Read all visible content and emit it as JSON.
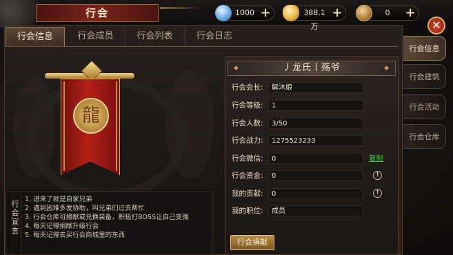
{
  "window": {
    "title": "行会"
  },
  "currency": [
    {
      "icon": "diamond-icon",
      "value": "1000"
    },
    {
      "icon": "gold-ingot-icon",
      "value": "388.1万"
    },
    {
      "icon": "coin-icon",
      "value": "0"
    }
  ],
  "tabs": [
    {
      "label": "行会信息",
      "active": true
    },
    {
      "label": "行会成员",
      "active": false
    },
    {
      "label": "行会列表",
      "active": false
    },
    {
      "label": "行会日志",
      "active": false
    }
  ],
  "side_tabs": [
    {
      "label": "行会信息",
      "active": true
    },
    {
      "label": "行会建筑",
      "active": false
    },
    {
      "label": "行会活动",
      "active": false
    },
    {
      "label": "行会仓库",
      "active": false
    }
  ],
  "guild": {
    "name": "丿龙氏丨殇爷",
    "fields": [
      {
        "label": "行会会长:",
        "value": "解沐娘"
      },
      {
        "label": "行会等级:",
        "value": "1"
      },
      {
        "label": "行会人数:",
        "value": "3/50"
      },
      {
        "label": "行会战力:",
        "value": "1275523233"
      },
      {
        "label": "行会微信:",
        "value": "0"
      },
      {
        "label": "行会资金:",
        "value": "0"
      },
      {
        "label": "我的贡献:",
        "value": "0"
      },
      {
        "label": "我的职位:",
        "value": "成员"
      }
    ],
    "copy_label": "复制",
    "donate_label": "行会捐献"
  },
  "declaration": {
    "label": "行会宣言",
    "lines": [
      "1. 进来了就是自家兄弟",
      "2. 遇到困难多发协助，叫兄弟们过去帮忙",
      "3. 行会仓库可捐献或兑换装备，积极打BOSS让自己变强",
      "4. 每天记得捐献升级行会",
      "5. 每天记得去买行会商城里的东西"
    ]
  },
  "colors": {
    "accent": "#c69b5c",
    "copy": "#3ec848",
    "banner_red": "#b4201a"
  }
}
